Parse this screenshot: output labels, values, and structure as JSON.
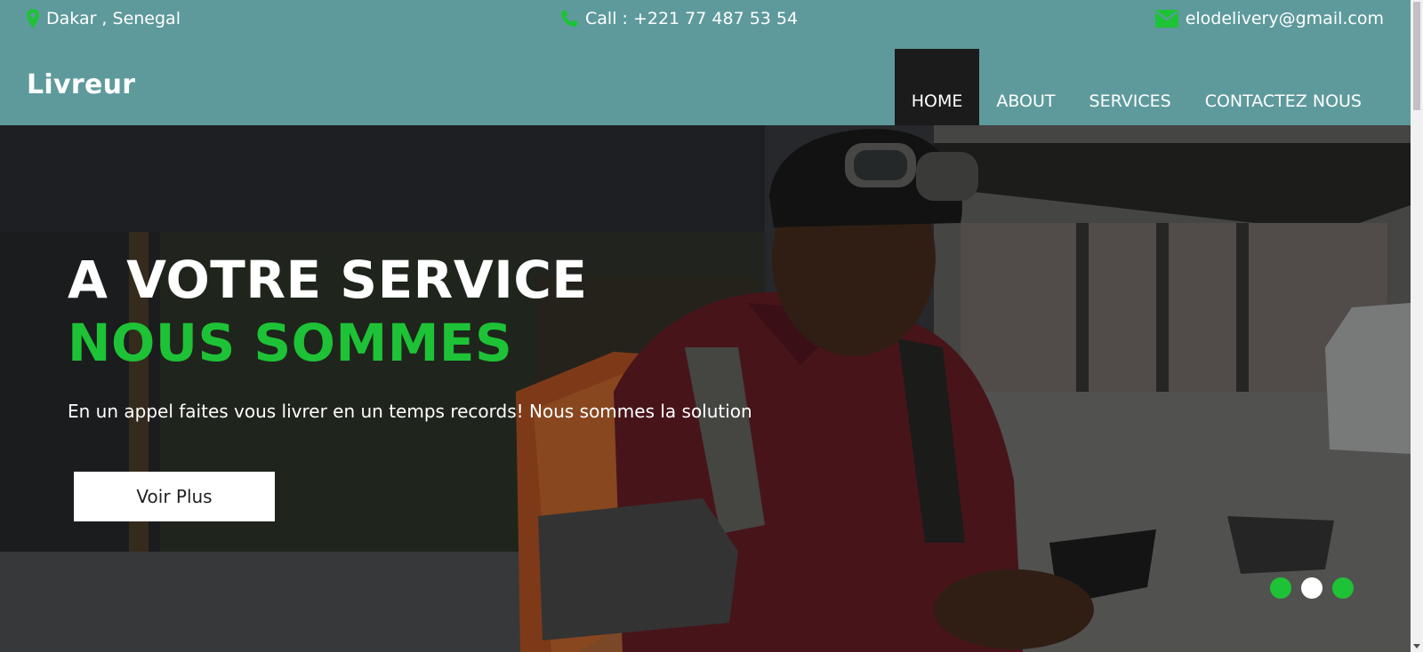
{
  "topbar": {
    "location": "Dakar , Senegal",
    "phone": "Call : +221 77 487 53 54",
    "email": "elodelivery@gmail.com",
    "icon_color": "#1ec236"
  },
  "header": {
    "brand": "Livreur",
    "nav": [
      {
        "label": "HOME",
        "active": true
      },
      {
        "label": "ABOUT",
        "active": false
      },
      {
        "label": "SERVICES",
        "active": false
      },
      {
        "label": "CONTACTEZ NOUS",
        "active": false
      }
    ]
  },
  "hero": {
    "title": "A VOTRE SERVICE",
    "subtitle": "NOUS SOMMES",
    "text": "En un appel faites vous livrer en un temps records! Nous sommes la solution",
    "button_label": "Voir Plus",
    "carousel_dots": [
      {
        "active": false
      },
      {
        "active": true
      },
      {
        "active": false
      }
    ]
  },
  "colors": {
    "bar_background": "#5e9a9c",
    "accent_green": "#1ec236",
    "nav_active": "#1b1b1b"
  }
}
